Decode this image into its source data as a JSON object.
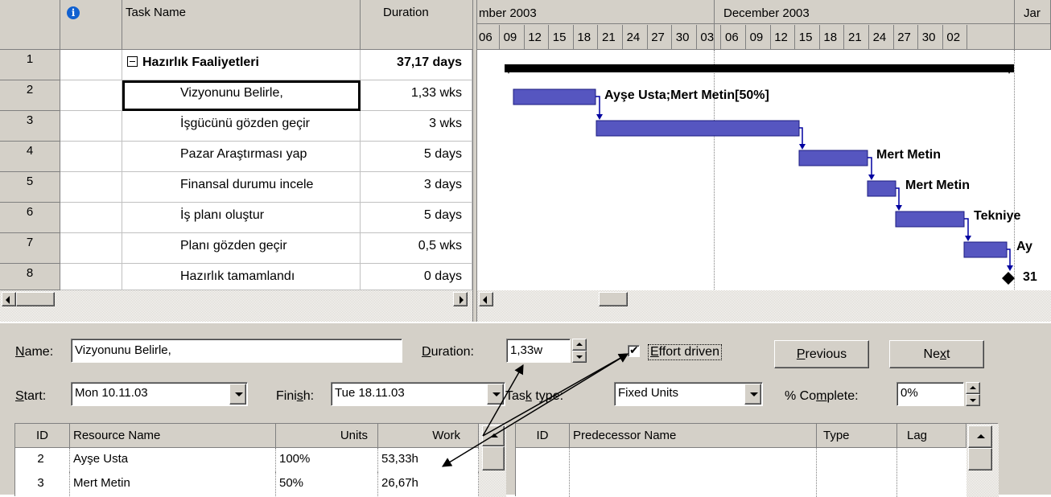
{
  "table": {
    "columns": {
      "info_icon": "i",
      "task_name": "Task Name",
      "duration": "Duration"
    },
    "rows": [
      {
        "id": "1",
        "name": "Hazırlık Faaliyetleri",
        "duration": "37,17 days",
        "summary": true
      },
      {
        "id": "2",
        "name": "Vizyonunu Belirle,",
        "duration": "1,33 wks"
      },
      {
        "id": "3",
        "name": "İşgücünü gözden geçir",
        "duration": "3 wks"
      },
      {
        "id": "4",
        "name": "Pazar Araştırması yap",
        "duration": "5 days"
      },
      {
        "id": "5",
        "name": "Finansal durumu incele",
        "duration": "3 days"
      },
      {
        "id": "6",
        "name": "İş planı oluştur",
        "duration": "5 days"
      },
      {
        "id": "7",
        "name": "Planı gözden geçir",
        "duration": "0,5 wks"
      },
      {
        "id": "8",
        "name": "Hazırlık tamamlandı",
        "duration": "0 days"
      }
    ],
    "summary_toggle": "−"
  },
  "gantt": {
    "months": [
      "mber 2003",
      "December 2003",
      "Jar"
    ],
    "days": [
      "06",
      "09",
      "12",
      "15",
      "18",
      "21",
      "24",
      "27",
      "30",
      "03",
      "06",
      "09",
      "12",
      "15",
      "18",
      "21",
      "24",
      "27",
      "30",
      "02"
    ],
    "bar_labels": [
      "Ayşe Usta;Mert Metin[50%]",
      "Mert Metin",
      "Mert Metin",
      "Tekniye",
      "Ay",
      "31"
    ]
  },
  "form": {
    "name_label": "Name:",
    "name_value": "Vizyonunu Belirle,",
    "duration_label": "Duration:",
    "duration_value": "1,33w",
    "effort_driven_label": "Effort driven",
    "effort_driven_checked": true,
    "previous_label": "Previous",
    "next_label": "Next",
    "start_label": "Start:",
    "start_value": "Mon 10.11.03",
    "finish_label": "Finish:",
    "finish_value": "Tue 18.11.03",
    "task_type_label": "Task type:",
    "task_type_value": "Fixed Units",
    "complete_label": "% Complete:",
    "complete_value": "0%"
  },
  "resources": {
    "headers": {
      "id": "ID",
      "name": "Resource Name",
      "units": "Units",
      "work": "Work"
    },
    "rows": [
      {
        "id": "2",
        "name": "Ayşe Usta",
        "units": "100%",
        "work": "53,33h"
      },
      {
        "id": "3",
        "name": "Mert Metin",
        "units": "50%",
        "work": "26,67h"
      }
    ]
  },
  "predecessors": {
    "headers": {
      "id": "ID",
      "name": "Predecessor Name",
      "type": "Type",
      "lag": "Lag"
    }
  },
  "colors": {
    "bar": "#4a4ab8",
    "face": "#d4d0c8",
    "summary": "#000000"
  },
  "icons": [
    "info-icon",
    "collapse-icon",
    "dropdown-arrow-icon",
    "spin-up-icon",
    "spin-down-icon",
    "scroll-left-icon",
    "scroll-right-icon",
    "scroll-up-icon",
    "checkbox-checked-icon"
  ]
}
